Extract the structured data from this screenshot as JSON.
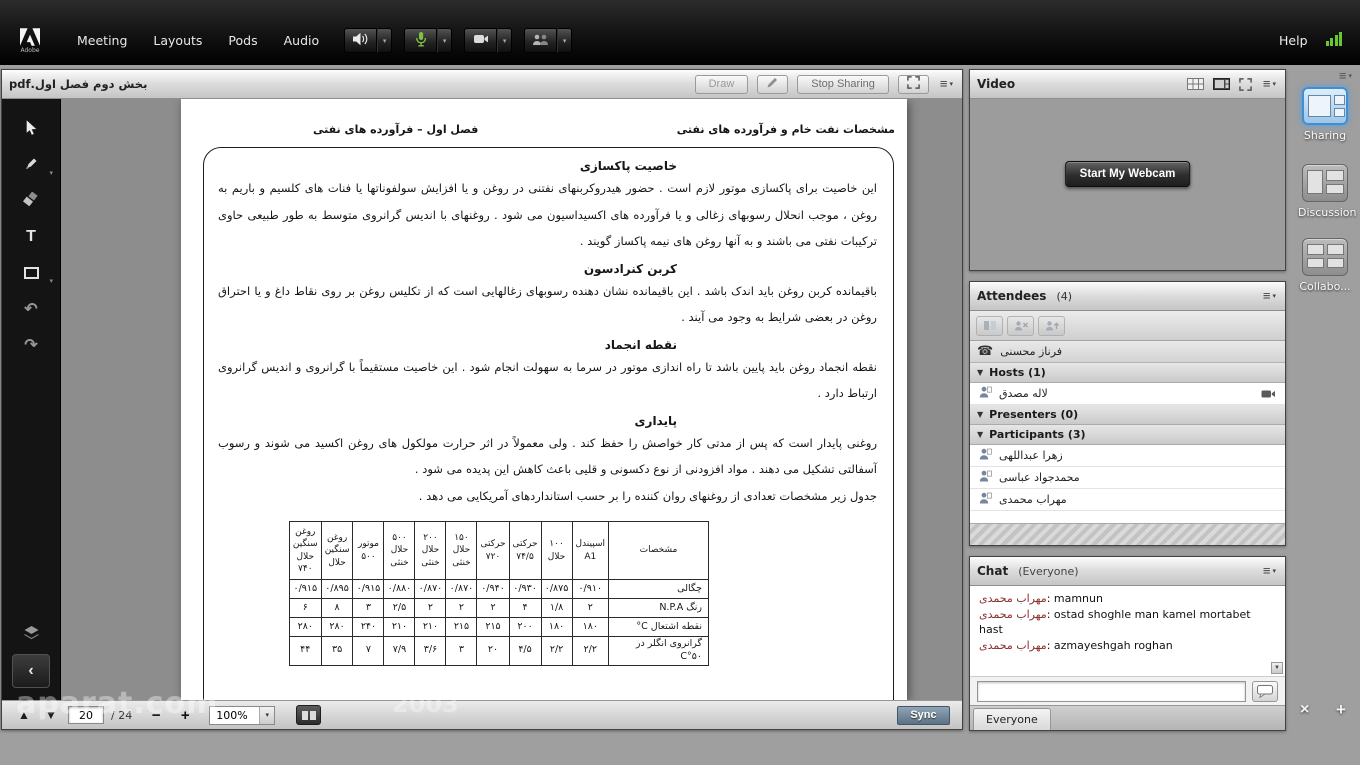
{
  "colors": {
    "mic_green": "#7cc142",
    "signal_green": "#67c832",
    "active_layout_blue": "#3f8fd6",
    "chat_sender_maroon": "#8b2e2e"
  },
  "icons": {
    "menu": "≡",
    "caret": "▾",
    "triangle_down": "▼",
    "arrow_up": "▲",
    "arrow_down": "▼",
    "minus": "−",
    "plus": "+",
    "undo": "↶",
    "redo": "↷",
    "collapse": "‹",
    "text_tool": "T",
    "close": "×",
    "add": "+",
    "phone": "☎"
  },
  "menubar": {
    "logo_label": "Adobe",
    "items": [
      "Meeting",
      "Layouts",
      "Pods",
      "Audio"
    ],
    "help": "Help"
  },
  "share_pod": {
    "title": "بخش دوم فصل اول.pdf",
    "draw_label": "Draw",
    "stop_sharing_label": "Stop Sharing",
    "footer": {
      "page_value": "20",
      "page_total": "/ 24",
      "zoom_value": "100%",
      "sync_label": "Sync"
    }
  },
  "document": {
    "header_right": "مشخصات نفت خام و فرآورده های نفتی",
    "header_center": "فصل اول – فرآورده های نفتی",
    "sections": [
      {
        "title": "خاصیت پاکسازی",
        "paragraphs": [
          "این خاصیت برای پاکسازی موتور لازم است . حضور هیدروکربنهای نفتنی در روغن و یا افزایش سولفوناتها یا فنات های کلسیم و باریم به روغن ، موجب انحلال رسوبهای زغالی و یا فرآورده های اکسیداسیون می شود . روغنهای با اندیس گرانروی متوسط به طور طبیعی حاوی ترکیبات نفتی می باشند و به آنها روغن های نیمه پاکساز گویند ."
        ]
      },
      {
        "title": "کربن کنرادسون",
        "paragraphs": [
          "باقیمانده کربن روغن باید اندک باشد . این باقیمانده نشان دهنده رسوبهای زغالهایی است که از تکلیس روغن بر روی نقاط داغ و یا احتراق روغن در بعضی شرایط به وجود می آیند ."
        ]
      },
      {
        "title": "نقطه انجماد",
        "paragraphs": [
          "نقطه انجماد روغن باید پایین باشد تا راه اندازی موتور در سرما به سهولت انجام شود . این خاصیت مستقیماً با گرانروی و اندیس گرانروی ارتباط دارد ."
        ]
      },
      {
        "title": "پایداری",
        "paragraphs": [
          "روغنی پایدار است که پس از مدتی کار خواصش را حفظ کند . ولی معمولاً در اثر حرارت مولکول های روغن اکسید می شوند و رسوب آسفالتی تشکیل می دهند . مواد افزودنی از نوع دکسونی و قلیی باعث کاهش این پدیده می شود .",
          "جدول زیر مشخصات تعدادی از روغنهای روان کننده را بر حسب استانداردهای آمریکایی می دهد ."
        ]
      }
    ],
    "table": {
      "label_header": "مشخصات",
      "headers": [
        "اسپیندل\nA1",
        "۱۰۰\nحلال",
        "حرکتی\n۷۴/۵",
        "حرکتی\n۷۲۰",
        "۱۵۰\nحلال\nخنثی",
        "۲۰۰\nحلال\nخنثی",
        "۵۰۰\nحلال\nخنثی",
        "موتور\n۵۰۰",
        "روغن\nسنگین\nحلال",
        "روغن\nسنگین\nحلال\n۷۴۰"
      ],
      "rows": [
        {
          "label": "چگالی",
          "values": [
            "۰/۹۱۰",
            "۰/۸۷۵",
            "۰/۹۳۰",
            "۰/۹۴۰",
            "۰/۸۷۰",
            "۰/۸۷۰",
            "۰/۸۸۰",
            "۰/۹۱۵",
            "۰/۸۹۵",
            "۰/۹۱۵"
          ]
        },
        {
          "label": "رنگ N.P.A",
          "values": [
            "۲",
            "۱/۸",
            "۴",
            "۲",
            "۲",
            "۲",
            "۲/۵",
            "۳",
            "۸",
            "۶"
          ]
        },
        {
          "label": "نقطه اشتعال C°",
          "values": [
            "۱۸۰",
            "۱۸۰",
            "۲۰۰",
            "۲۱۵",
            "۲۱۵",
            "۲۱۰",
            "۲۱۰",
            "۲۴۰",
            "۲۸۰",
            "۲۸۰"
          ]
        },
        {
          "label": "گرانروی انگلر در C°۵۰",
          "values": [
            "۲/۲",
            "۲/۲",
            "۴/۵",
            "۲۰",
            "۳",
            "۳/۶",
            "۷/۹",
            "۷",
            "۳۵",
            "۴۴"
          ]
        }
      ]
    }
  },
  "video_pod": {
    "title": "Video",
    "start_webcam_label": "Start My Webcam"
  },
  "attendees": {
    "title": "Attendees",
    "count": "(4)",
    "phone_user": "فرناز محسنی",
    "groups": [
      {
        "label": "Hosts (1)",
        "members": [
          {
            "name": "لاله مصدق",
            "webcam": true
          }
        ]
      },
      {
        "label": "Presenters (0)",
        "members": []
      },
      {
        "label": "Participants (3)",
        "members": [
          {
            "name": "زهرا عبداللهی"
          },
          {
            "name": "محمدجواد عباسی"
          },
          {
            "name": "مهراب محمدی"
          }
        ]
      }
    ]
  },
  "chat": {
    "title": "Chat",
    "scope": "(Everyone)",
    "messages": [
      {
        "sender": "مهراب محمدی",
        "text": "mamnun"
      },
      {
        "sender": "مهراب محمدی",
        "text": "ostad shoghle man kamel mortabet hast"
      },
      {
        "sender": "مهراب محمدی",
        "text": "azmayeshgah roghan"
      }
    ],
    "input_value": "",
    "everyone_tab": "Everyone"
  },
  "layout_bar": {
    "items": [
      "Sharing",
      "Discussion",
      "Collabo..."
    ]
  },
  "watermark": {
    "site": "aparat.com",
    "code": "2003"
  }
}
